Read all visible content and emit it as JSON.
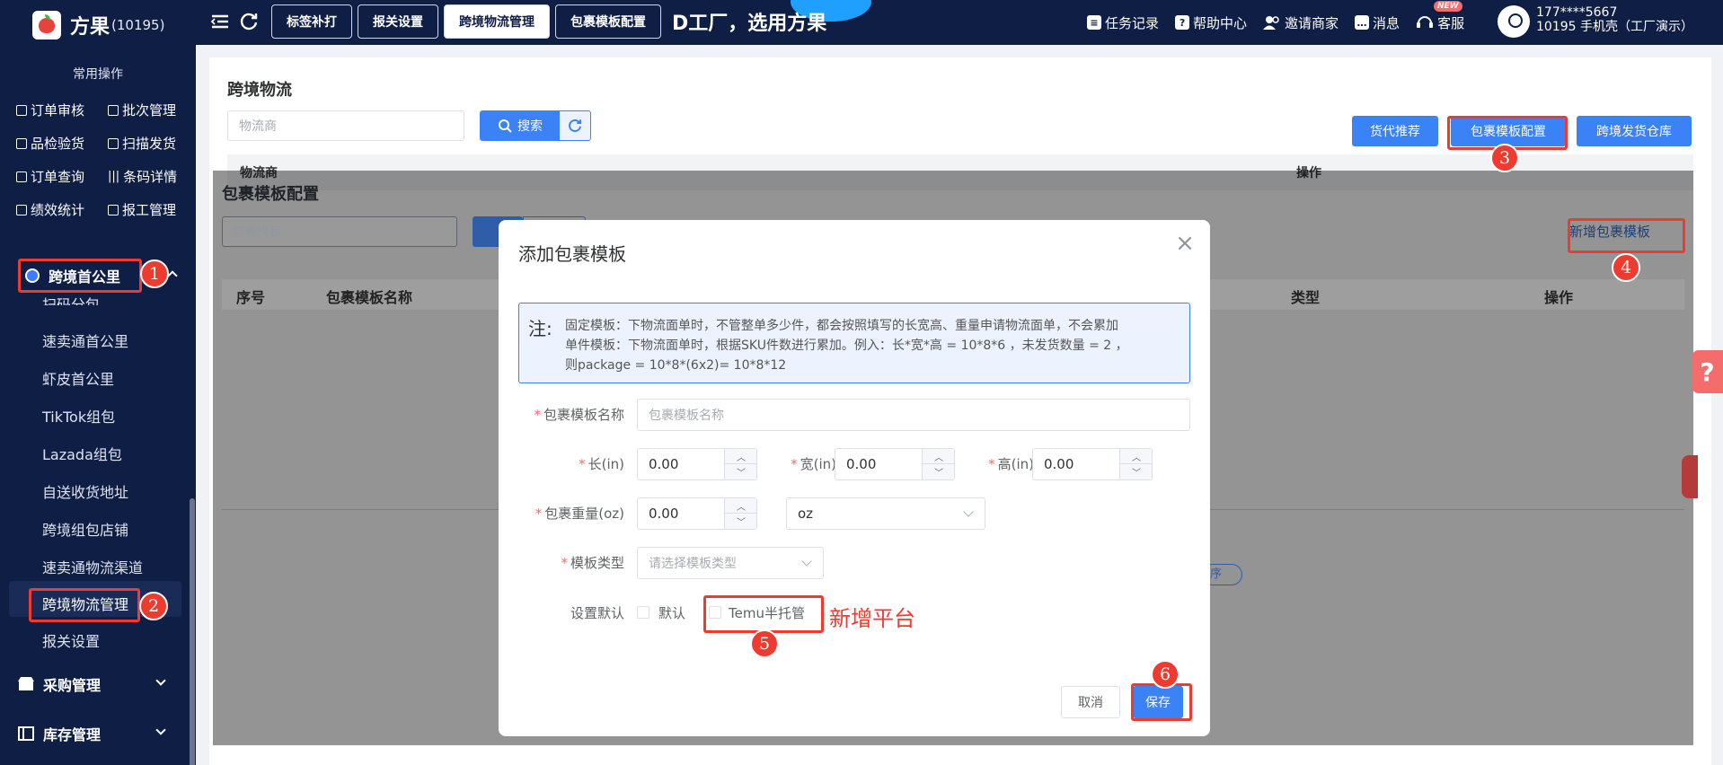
{
  "app": {
    "name": "方果",
    "code": "(10195)"
  },
  "top_tabs": [
    {
      "label": "标签补打",
      "active": false
    },
    {
      "label": "报关设置",
      "active": false
    },
    {
      "label": "跨境物流管理",
      "active": true
    },
    {
      "label": "包裹模板配置",
      "active": false
    }
  ],
  "banner": "D工厂，选用方果",
  "top_right": {
    "tasks": "任务记录",
    "help": "帮助中心",
    "invite": "邀请商家",
    "messages": "消息",
    "service": "客服",
    "new_badge": "NEW"
  },
  "user": {
    "phone": "177****5667",
    "desc": "10195 手机壳（工厂演示）"
  },
  "sidebar": {
    "section_title": "常用操作",
    "quick_ops": [
      "订单审核",
      "批次管理",
      "品检验货",
      "扫描发货",
      "订单查询",
      "条码详情",
      "绩效统计",
      "报工管理"
    ],
    "group_crossborder": "跨境首公里",
    "partial_item": "扫码分包",
    "items": [
      "速卖通首公里",
      "虾皮首公里",
      "TikTok组包",
      "Lazada组包",
      "自送收货地址",
      "跨境组包店铺",
      "速卖通物流渠道",
      "跨境物流管理",
      "报关设置"
    ],
    "group_purchase": "采购管理",
    "group_inventory": "库存管理"
  },
  "main": {
    "title": "跨境物流",
    "search_placeholder": "物流商",
    "search_button": "搜索",
    "buttons": [
      "货代推荐",
      "包裹模板配置",
      "跨境发货仓库"
    ],
    "table_headers": [
      "物流商",
      "操作"
    ]
  },
  "panel": {
    "title": "包裹模板配置",
    "search_placeholder": "包裹模板",
    "add_button": "新增包裹模板",
    "table_headers": [
      "序号",
      "包裹模板名称",
      "类型",
      "操作"
    ],
    "pill_fragment": "序"
  },
  "dialog": {
    "title": "添加包裹模板",
    "note_mark": "注:",
    "note_lines": [
      "固定模板：下物流面单时，不管整单多少件，都会按照填写的长宽高、重量申请物流面单，不会累加",
      "单件模板：下物流面单时，根据SKU件数进行累加。例入：长*宽*高 = 10*8*6 ，未发货数量 = 2 ，",
      "则package = 10*8*(6x2)= 10*8*12"
    ],
    "name_label": "包裹模板名称",
    "name_placeholder": "包裹模板名称",
    "length_label": "长(in)",
    "length_value": "0.00",
    "width_label": "宽(in)",
    "width_value": "0.00",
    "height_label": "高(in)",
    "height_value": "0.00",
    "weight_label": "包裹重量(oz)",
    "weight_value": "0.00",
    "weight_unit": "oz",
    "type_label": "模板类型",
    "type_placeholder": "请选择模板类型",
    "default_label": "设置默认",
    "default_option": "默认",
    "temu_option": "Temu半托管",
    "platform_note": "新增平台",
    "cancel_button": "取消",
    "save_button": "保存"
  },
  "help_tab": "?",
  "markers": [
    "1",
    "2",
    "3",
    "4",
    "5",
    "6"
  ],
  "colors": {
    "accent": "#3b82f6",
    "nav_bg": "#0f1e45",
    "highlight": "#ef3b2f"
  }
}
